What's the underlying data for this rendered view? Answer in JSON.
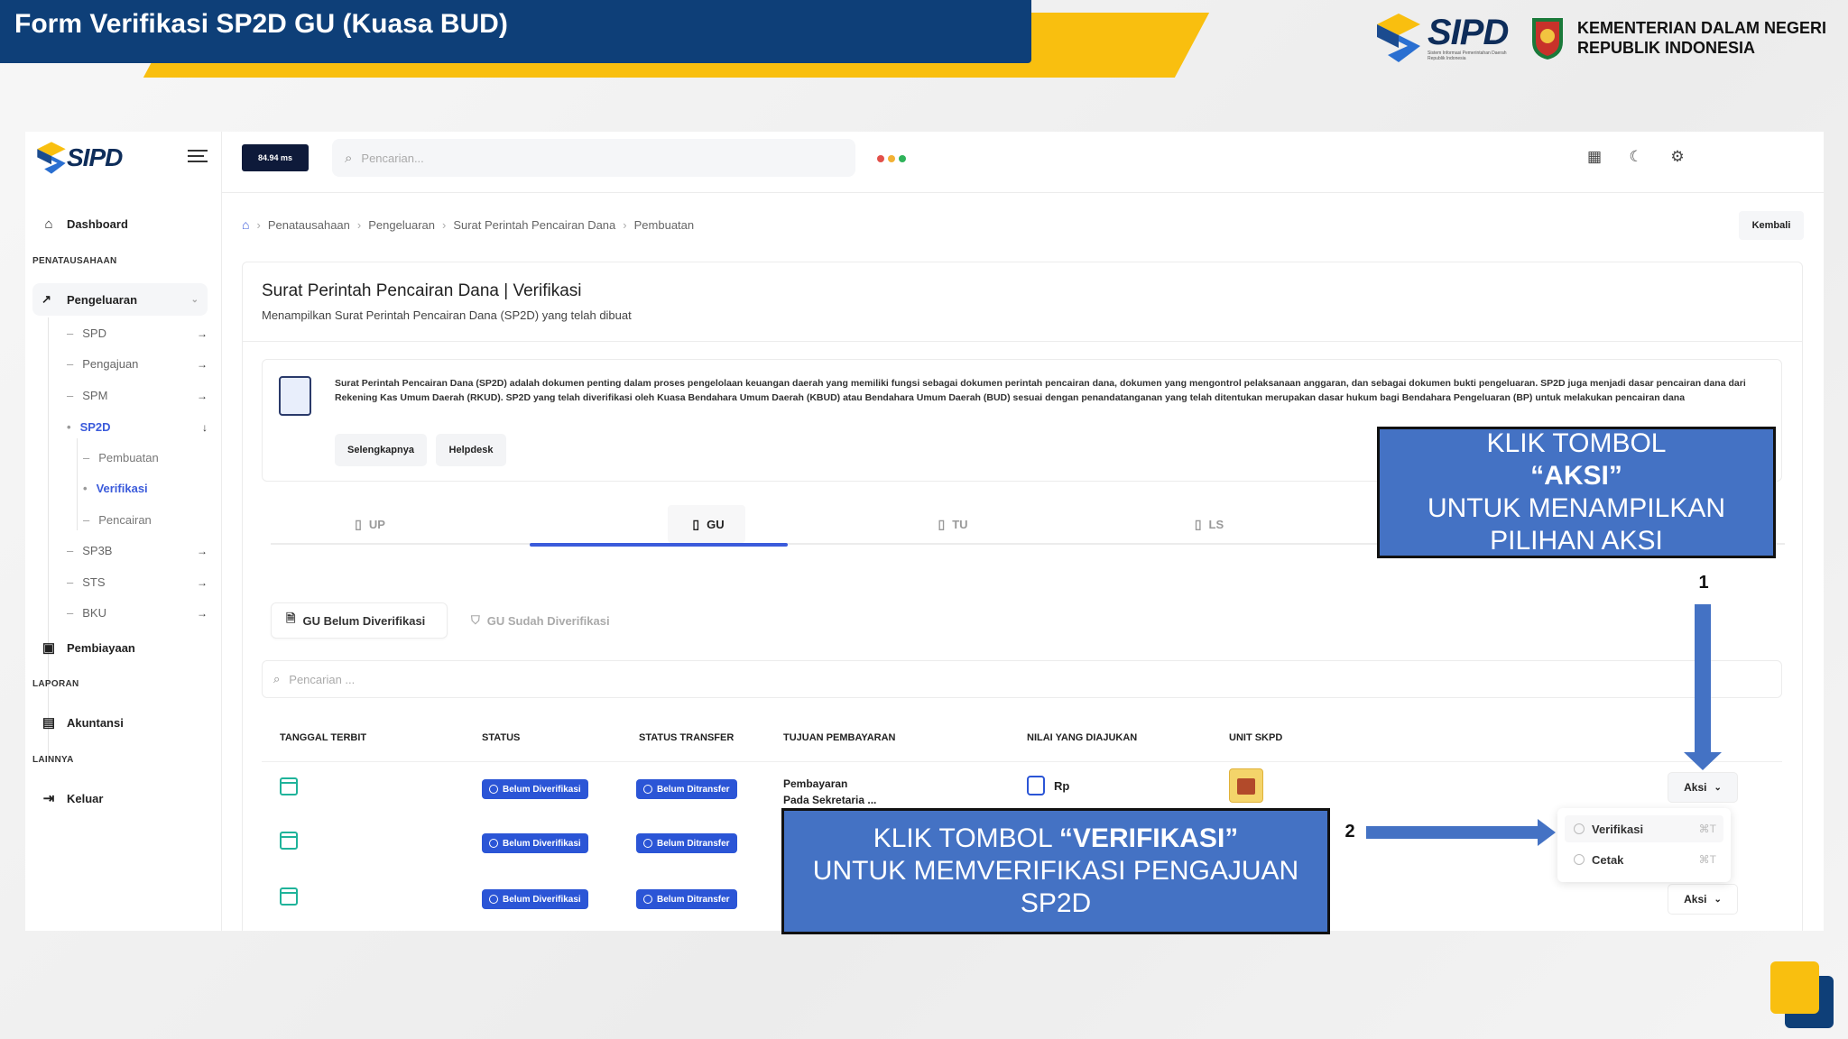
{
  "slide": {
    "title": "Form Verifikasi SP2D GU (Kuasa BUD)",
    "brand": "SIPD",
    "brand_sub": "Sistem Informasi Pemerintahan Daerah Republik Indonesia",
    "ministry_line1": "KEMENTERIAN DALAM NEGERI",
    "ministry_line2": "REPUBLIK INDONESIA",
    "colors": {
      "navy": "#0e3f78",
      "yellow": "#f9bf0f",
      "callout": "#4472c4",
      "primary": "#3b5bdb"
    }
  },
  "app": {
    "logo": "SIPD",
    "speed": "84.94 ms",
    "search_placeholder": "Pencarian...",
    "top_icons": [
      "layout-icon",
      "moon-icon",
      "settings-icon"
    ],
    "sidebar": {
      "dashboard": "Dashboard",
      "section_penatausahaan": "PENATAUSAHAAN",
      "pengeluaran": "Pengeluaran",
      "items": [
        "SPD",
        "Pengajuan",
        "SPM",
        "SP2D"
      ],
      "sp2d_children": [
        "Pembuatan",
        "Verifikasi",
        "Pencairan"
      ],
      "items_after": [
        "SP3B",
        "STS",
        "BKU"
      ],
      "pembiayaan": "Pembiayaan",
      "section_laporan": "LAPORAN",
      "akuntansi": "Akuntansi",
      "section_lainnya": "LAINNYA",
      "keluar": "Keluar"
    },
    "breadcrumb": [
      "Penatausahaan",
      "Pengeluaran",
      "Surat Perintah Pencairan Dana",
      "Pembuatan"
    ],
    "back_button": "Kembali",
    "page_title": "Surat Perintah Pencairan Dana | Verifikasi",
    "page_subtitle": "Menampilkan Surat Perintah Pencairan Dana (SP2D) yang telah dibuat",
    "info_text": "Surat Perintah Pencairan Dana (SP2D) adalah dokumen penting dalam proses pengelolaan keuangan daerah yang memiliki fungsi sebagai dokumen perintah pencairan dana, dokumen yang mengontrol pelaksanaan anggaran, dan sebagai dokumen bukti pengeluaran. SP2D juga menjadi dasar pencairan dana dari Rekening Kas Umum Daerah (RKUD). SP2D yang telah diverifikasi oleh Kuasa Bendahara Umum Daerah (KBUD) atau Bendahara Umum Daerah (BUD) sesuai dengan penandatanganan yang telah ditentukan merupakan dasar hukum bagi Bendahara Pengeluaran (BP) untuk melakukan pencairan dana",
    "info_buttons": [
      "Selengkapnya",
      "Helpdesk"
    ],
    "tabs": [
      "UP",
      "GU",
      "TU",
      "LS"
    ],
    "active_tab": "GU",
    "subtabs": [
      "GU Belum Diverifikasi",
      "GU Sudah Diverifikasi"
    ],
    "table_search_placeholder": "Pencarian ...",
    "columns": [
      "TANGGAL TERBIT",
      "STATUS",
      "STATUS TRANSFER",
      "TUJUAN PEMBAYARAN",
      "NILAI YANG DIAJUKAN",
      "UNIT SKPD"
    ],
    "rows": [
      {
        "status": "Belum Diverifikasi",
        "transfer": "Belum Ditransfer",
        "tujuan1": "Pembayaran",
        "tujuan2": "Pada Sekretaria ...",
        "nilai": "Rp",
        "aksi": "Aksi"
      },
      {
        "status": "Belum Diverifikasi",
        "transfer": "Belum Ditransfer"
      },
      {
        "status": "Belum Diverifikasi",
        "transfer": "Belum Ditransfer",
        "aksi": "Aksi"
      }
    ],
    "dropdown": [
      {
        "label": "Verifikasi",
        "shortcut": "⌘T"
      },
      {
        "label": "Cetak",
        "shortcut": "⌘T"
      }
    ]
  },
  "annotations": {
    "step1_number": "1",
    "step1_line1": "KLIK TOMBOL",
    "step1_line2": "“AKSI”",
    "step1_line3": "UNTUK MENAMPILKAN",
    "step1_line4": "PILIHAN AKSI",
    "step2_number": "2",
    "step2_prefix": "KLIK TOMBOL ",
    "step2_bold": "“VERIFIKASI”",
    "step2_line2": "UNTUK MEMVERIFIKASI PENGAJUAN",
    "step2_line3": "SP2D"
  }
}
